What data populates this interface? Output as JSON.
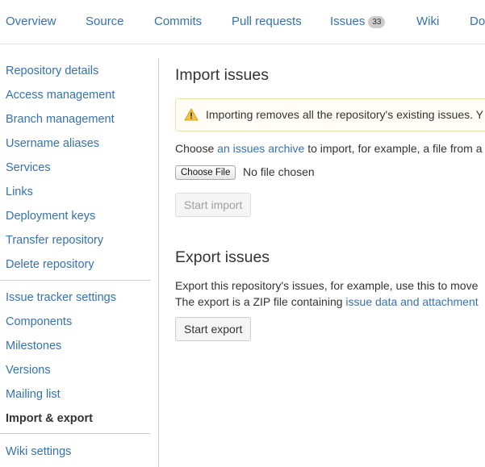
{
  "topnav": {
    "tabs": [
      {
        "label": "Overview"
      },
      {
        "label": "Source"
      },
      {
        "label": "Commits"
      },
      {
        "label": "Pull requests"
      },
      {
        "label": "Issues",
        "badge": "33"
      },
      {
        "label": "Wiki"
      },
      {
        "label": "Dow"
      }
    ]
  },
  "sidebar": {
    "items": [
      {
        "label": "Repository details"
      },
      {
        "label": "Access management"
      },
      {
        "label": "Branch management"
      },
      {
        "label": "Username aliases"
      },
      {
        "label": "Services"
      },
      {
        "label": "Links"
      },
      {
        "label": "Deployment keys"
      },
      {
        "label": "Transfer repository"
      },
      {
        "label": "Delete repository"
      },
      {
        "label": "Issue tracker settings"
      },
      {
        "label": "Components"
      },
      {
        "label": "Milestones"
      },
      {
        "label": "Versions"
      },
      {
        "label": "Mailing list"
      },
      {
        "label": "Import & export"
      },
      {
        "label": "Wiki settings"
      }
    ],
    "active": "Import & export"
  },
  "import_section": {
    "title": "Import issues",
    "warning": "Importing removes all the repository's existing issues. Y",
    "choose_prefix": "Choose ",
    "choose_link": "an issues archive",
    "choose_suffix": " to import, for example, a file from a",
    "file_button": "Choose File",
    "file_status": "No file chosen",
    "start_button": "Start import"
  },
  "export_section": {
    "title": "Export issues",
    "line1": "Export this repository's issues, for example, use this to move",
    "line2_prefix": "The export is a ZIP file containing ",
    "line2_link": "issue data and attachment",
    "start_button": "Start export"
  },
  "colors": {
    "link": "#3572b0",
    "text": "#333333",
    "warning_bg": "#fffdf6",
    "warning_icon": "#f2c24c"
  }
}
